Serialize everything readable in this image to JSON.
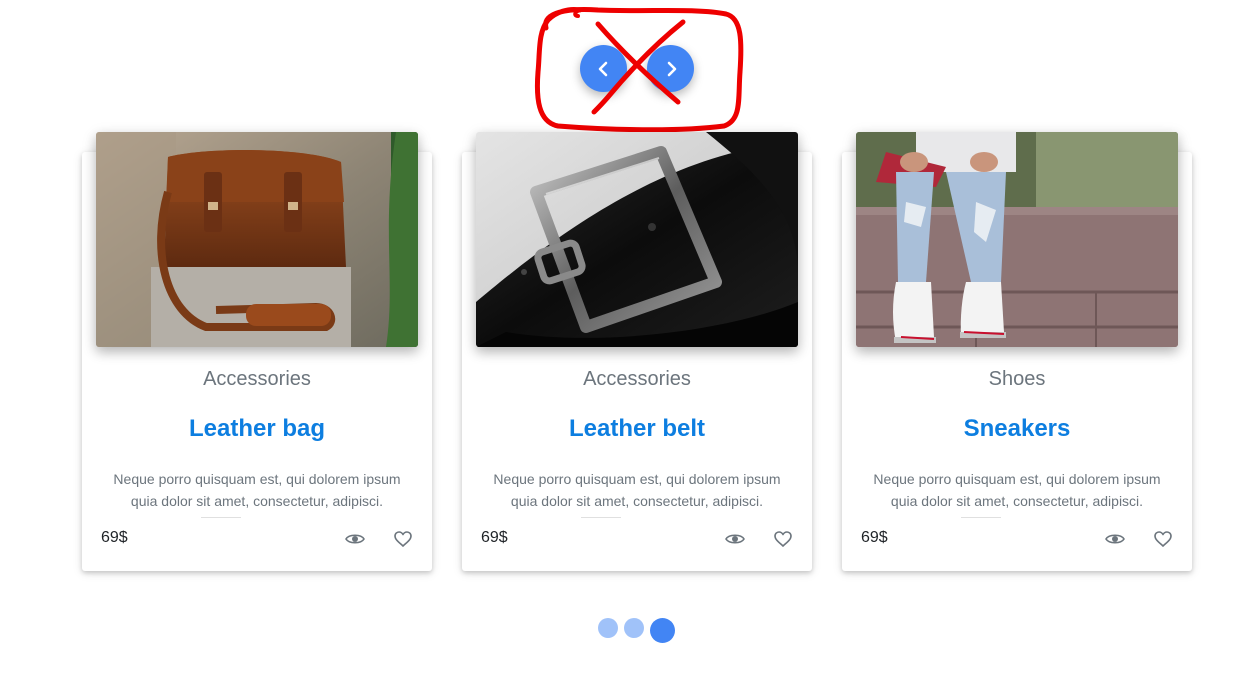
{
  "carousel": {
    "prev_icon": "chevron-left-icon",
    "next_icon": "chevron-right-icon",
    "accent_color": "#4285f4"
  },
  "annotation": {
    "color": "#ee0000",
    "shape": "red circle with X over navigation arrows"
  },
  "cards": [
    {
      "image": "leather-bag-photo",
      "category": "Accessories",
      "title": "Leather bag",
      "description": "Neque porro quisquam est, qui dolorem ipsum quia dolor sit amet, consectetur, adipisci.",
      "price": "69$",
      "view_icon": "eye-icon",
      "like_icon": "heart-icon"
    },
    {
      "image": "leather-belt-photo",
      "category": "Accessories",
      "title": "Leather belt",
      "description": "Neque porro quisquam est, qui dolorem ipsum quia dolor sit amet, consectetur, adipisci.",
      "price": "69$",
      "view_icon": "eye-icon",
      "like_icon": "heart-icon"
    },
    {
      "image": "sneakers-photo",
      "category": "Shoes",
      "title": "Sneakers",
      "description": "Neque porro quisquam est, qui dolorem ipsum quia dolor sit amet, consectetur, adipisci.",
      "price": "69$",
      "view_icon": "eye-icon",
      "like_icon": "heart-icon"
    }
  ],
  "pagination": {
    "count": 3,
    "active_index": 2
  },
  "colors": {
    "title": "#0d7ee0",
    "muted_text": "#6c757d",
    "price_text": "#212529"
  }
}
